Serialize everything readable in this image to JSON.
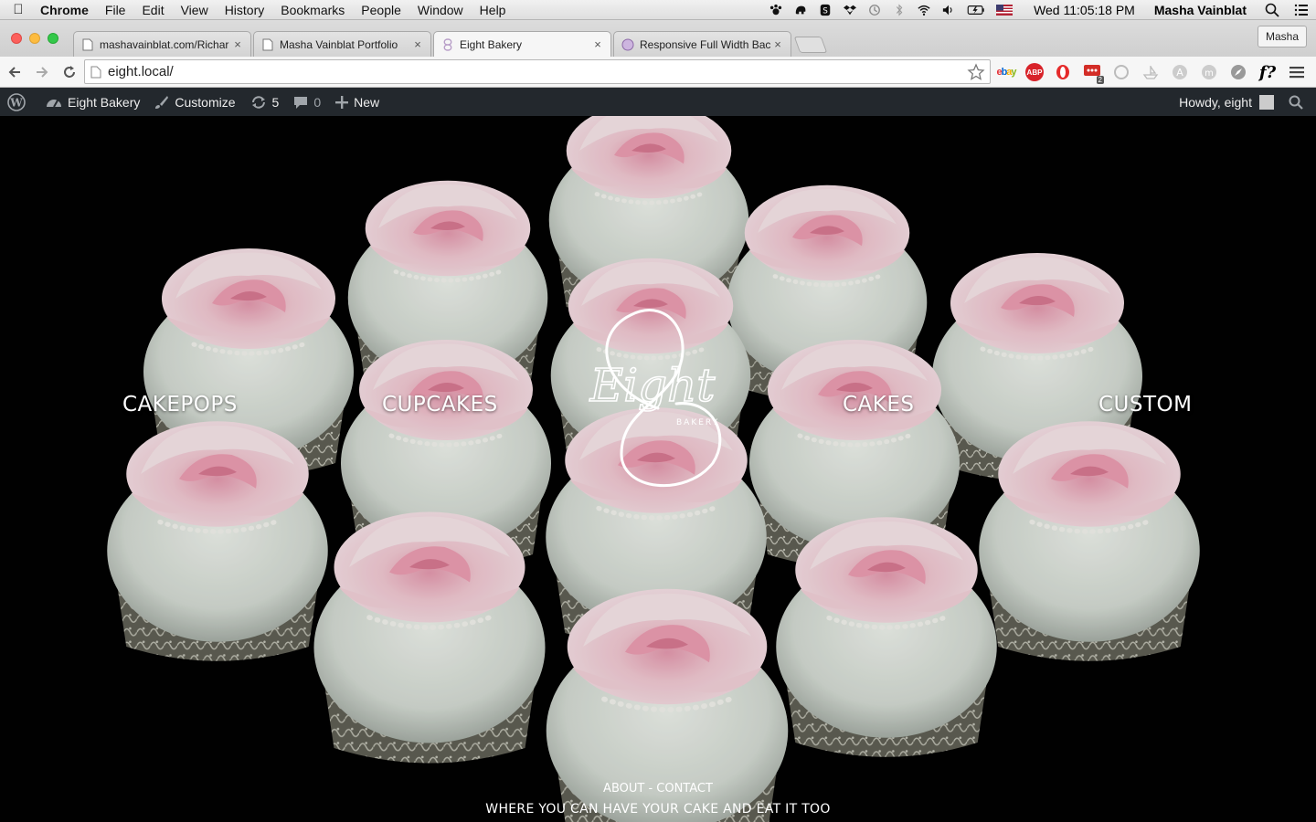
{
  "menubar": {
    "app_name": "Chrome",
    "menus": [
      "File",
      "Edit",
      "View",
      "History",
      "Bookmarks",
      "People",
      "Window",
      "Help"
    ],
    "clock": "Wed 11:05:18 PM",
    "user": "Masha Vainblat"
  },
  "tabs": [
    {
      "title": "mashavainblat.com/Richar",
      "active": false
    },
    {
      "title": "Masha Vainblat Portfolio",
      "active": false
    },
    {
      "title": "Eight Bakery",
      "active": true
    },
    {
      "title": "Responsive Full Width Bac",
      "active": false
    }
  ],
  "profile_name": "Masha",
  "address_bar": {
    "url": "eight.local/"
  },
  "extensions": {
    "ebay": "ebay",
    "abp": "ABP",
    "badge_count": "2",
    "fquestion": "f?"
  },
  "adminbar": {
    "site_name": "Eight Bakery",
    "customize": "Customize",
    "updates_count": "5",
    "comments_count": "0",
    "new_label": "New",
    "howdy": "Howdy, eight"
  },
  "site": {
    "logo": {
      "script": "Eight",
      "subtitle": "BAKERY"
    },
    "nav": [
      "CAKEPOPS",
      "CUPCAKES",
      "CAKES",
      "CUSTOM"
    ],
    "footer_links": "ABOUT - CONTACT",
    "tagline": "WHERE YOU CAN HAVE YOUR CAKE AND EAT IT TOO"
  },
  "colors": {
    "admin_bar_bg": "#23282d",
    "hero_bg": "#020202",
    "rose_pink": "#f0c6d0",
    "frosting": "#dfe5dd"
  }
}
